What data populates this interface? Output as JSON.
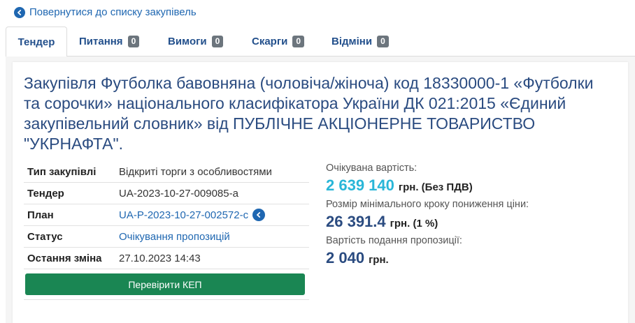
{
  "back": {
    "label": "Повернутися до списку закупівель",
    "icon": "arrow-left-circle-icon"
  },
  "tabs": [
    {
      "label": "Тендер",
      "active": true
    },
    {
      "label": "Питання",
      "count": "0"
    },
    {
      "label": "Вимоги",
      "count": "0"
    },
    {
      "label": "Скарги",
      "count": "0"
    },
    {
      "label": "Відміни",
      "count": "0"
    }
  ],
  "title": "Закупівля Футболка бавовняна (чоловіча/жіноча) код 18330000-1 «Футболки та сорочки» національного класифікатора України ДК 021:2015 «Єдиний закупівельний словник» від ПУБЛІЧНЕ АКЦІОНЕРНЕ ТОВАРИСТВО \"УКРНАФТА\".",
  "info": {
    "type_label": "Тип закупівлі",
    "type_value": "Відкриті торги з особливостями",
    "tender_label": "Тендер",
    "tender_value": "UA-2023-10-27-009085-a",
    "plan_label": "План",
    "plan_value": "UA-P-2023-10-27-002572-c",
    "status_label": "Статус",
    "status_value": "Очікування пропозицій",
    "changed_label": "Остання зміна",
    "changed_value": "27.10.2023 14:43",
    "kep_button": "Перевірити КЕП"
  },
  "prices": {
    "expected_label": "Очікувана вартість:",
    "expected_value": "2 639 140",
    "expected_unit": "грн. (Без ПДВ)",
    "step_label": "Розмір мінімального кроку пониження ціни:",
    "step_value": "26 391.4",
    "step_unit": "грн. (1 %)",
    "submission_label": "Вартість подання пропозиції:",
    "submission_value": "2 040",
    "submission_unit": "грн."
  },
  "colors": {
    "brand": "#1f67b1",
    "title": "#2a4b80",
    "accent": "#29b6d8",
    "button": "#1a8653",
    "badge": "#6c757d"
  }
}
